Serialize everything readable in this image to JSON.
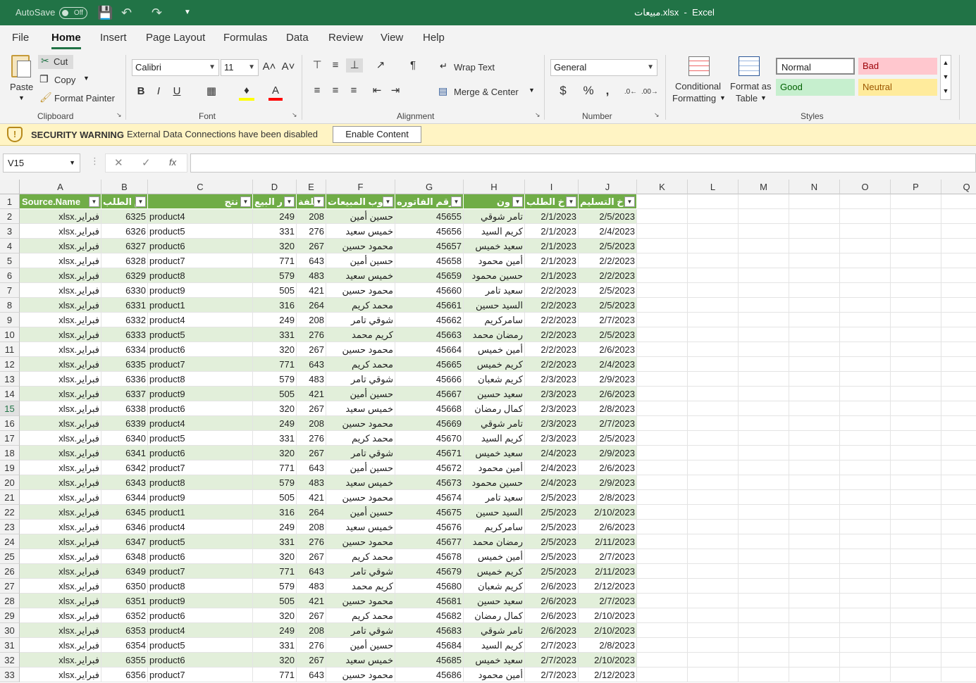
{
  "titlebar": {
    "autosave_label": "AutoSave",
    "autosave_state": "Off",
    "filename": "مبيعات.xlsx",
    "app": "Excel"
  },
  "menu": [
    "File",
    "Home",
    "Insert",
    "Page Layout",
    "Formulas",
    "Data",
    "Review",
    "View",
    "Help"
  ],
  "ribbon": {
    "clipboard": {
      "paste": "Paste",
      "cut": "Cut",
      "copy": "Copy",
      "format_painter": "Format Painter",
      "label": "Clipboard"
    },
    "font": {
      "name": "Calibri",
      "size": "11",
      "label": "Font",
      "bold": "B",
      "italic": "I",
      "underline": "U"
    },
    "alignment": {
      "wrap_text": "Wrap Text",
      "merge_center": "Merge & Center",
      "label": "Alignment"
    },
    "number": {
      "format": "General",
      "label": "Number"
    },
    "styles": {
      "conditional": "Conditional",
      "formatting": "Formatting",
      "format_as": "Format as",
      "table": "Table",
      "normal": "Normal",
      "bad": "Bad",
      "good": "Good",
      "neutral": "Neutral",
      "label": "Styles"
    }
  },
  "security": {
    "title": "SECURITY WARNING",
    "message": "External Data Connections have been disabled",
    "button": "Enable Content"
  },
  "formula_bar": {
    "name_box": "V15",
    "fx": "fx"
  },
  "columns": [
    "A",
    "B",
    "C",
    "D",
    "E",
    "F",
    "G",
    "H",
    "I",
    "J",
    "K",
    "L",
    "M",
    "N",
    "O",
    "P",
    "Q"
  ],
  "header_row": [
    "Source.Name",
    "م الطلب",
    "نتج",
    "ر البيع",
    "كلفة",
    "وب المبيعات",
    "رقم الفاتوره.",
    "ون",
    "خ الطلب",
    "خ التسليم"
  ],
  "rows": [
    [
      "فبراير.xlsx",
      "6325",
      "product4",
      "249",
      "208",
      "حسين أمين",
      "45655",
      "تامر شوقي",
      "2/1/2023",
      "2/5/2023"
    ],
    [
      "فبراير.xlsx",
      "6326",
      "product5",
      "331",
      "276",
      "خميس سعيد",
      "45656",
      "كريم السيد",
      "2/1/2023",
      "2/4/2023"
    ],
    [
      "فبراير.xlsx",
      "6327",
      "product6",
      "320",
      "267",
      "محمود حسين",
      "45657",
      "سعيد خميس",
      "2/1/2023",
      "2/5/2023"
    ],
    [
      "فبراير.xlsx",
      "6328",
      "product7",
      "771",
      "643",
      "حسين أمين",
      "45658",
      "أمين محمود",
      "2/1/2023",
      "2/2/2023"
    ],
    [
      "فبراير.xlsx",
      "6329",
      "product8",
      "579",
      "483",
      "خميس سعيد",
      "45659",
      "حسين محمود",
      "2/1/2023",
      "2/2/2023"
    ],
    [
      "فبراير.xlsx",
      "6330",
      "product9",
      "505",
      "421",
      "محمود حسين",
      "45660",
      "سعيد تامر",
      "2/2/2023",
      "2/5/2023"
    ],
    [
      "فبراير.xlsx",
      "6331",
      "product1",
      "316",
      "264",
      "محمد كريم",
      "45661",
      "السيد حسين",
      "2/2/2023",
      "2/5/2023"
    ],
    [
      "فبراير.xlsx",
      "6332",
      "product4",
      "249",
      "208",
      "شوقي تامر",
      "45662",
      "سامركريم",
      "2/2/2023",
      "2/7/2023"
    ],
    [
      "فبراير.xlsx",
      "6333",
      "product5",
      "331",
      "276",
      "كريم محمد",
      "45663",
      "رمضان محمد",
      "2/2/2023",
      "2/5/2023"
    ],
    [
      "فبراير.xlsx",
      "6334",
      "product6",
      "320",
      "267",
      "محمود حسين",
      "45664",
      "أمين خميس",
      "2/2/2023",
      "2/6/2023"
    ],
    [
      "فبراير.xlsx",
      "6335",
      "product7",
      "771",
      "643",
      "محمد كريم",
      "45665",
      "كريم خميس",
      "2/2/2023",
      "2/4/2023"
    ],
    [
      "فبراير.xlsx",
      "6336",
      "product8",
      "579",
      "483",
      "شوقي تامر",
      "45666",
      "كريم شعبان",
      "2/3/2023",
      "2/9/2023"
    ],
    [
      "فبراير.xlsx",
      "6337",
      "product9",
      "505",
      "421",
      "حسين أمين",
      "45667",
      "سعيد حسين",
      "2/3/2023",
      "2/6/2023"
    ],
    [
      "فبراير.xlsx",
      "6338",
      "product6",
      "320",
      "267",
      "خميس سعيد",
      "45668",
      "كمال رمضان",
      "2/3/2023",
      "2/8/2023"
    ],
    [
      "فبراير.xlsx",
      "6339",
      "product4",
      "249",
      "208",
      "محمود حسين",
      "45669",
      "تامر شوقي",
      "2/3/2023",
      "2/7/2023"
    ],
    [
      "فبراير.xlsx",
      "6340",
      "product5",
      "331",
      "276",
      "محمد كريم",
      "45670",
      "كريم السيد",
      "2/3/2023",
      "2/5/2023"
    ],
    [
      "فبراير.xlsx",
      "6341",
      "product6",
      "320",
      "267",
      "شوقي تامر",
      "45671",
      "سعيد خميس",
      "2/4/2023",
      "2/9/2023"
    ],
    [
      "فبراير.xlsx",
      "6342",
      "product7",
      "771",
      "643",
      "حسين أمين",
      "45672",
      "أمين محمود",
      "2/4/2023",
      "2/6/2023"
    ],
    [
      "فبراير.xlsx",
      "6343",
      "product8",
      "579",
      "483",
      "خميس سعيد",
      "45673",
      "حسين محمود",
      "2/4/2023",
      "2/9/2023"
    ],
    [
      "فبراير.xlsx",
      "6344",
      "product9",
      "505",
      "421",
      "محمود حسين",
      "45674",
      "سعيد تامر",
      "2/5/2023",
      "2/8/2023"
    ],
    [
      "فبراير.xlsx",
      "6345",
      "product1",
      "316",
      "264",
      "حسين أمين",
      "45675",
      "السيد حسين",
      "2/5/2023",
      "2/10/2023"
    ],
    [
      "فبراير.xlsx",
      "6346",
      "product4",
      "249",
      "208",
      "خميس سعيد",
      "45676",
      "سامركريم",
      "2/5/2023",
      "2/6/2023"
    ],
    [
      "فبراير.xlsx",
      "6347",
      "product5",
      "331",
      "276",
      "محمود حسين",
      "45677",
      "رمضان محمد",
      "2/5/2023",
      "2/11/2023"
    ],
    [
      "فبراير.xlsx",
      "6348",
      "product6",
      "320",
      "267",
      "محمد كريم",
      "45678",
      "أمين خميس",
      "2/5/2023",
      "2/7/2023"
    ],
    [
      "فبراير.xlsx",
      "6349",
      "product7",
      "771",
      "643",
      "شوقي تامر",
      "45679",
      "كريم خميس",
      "2/5/2023",
      "2/11/2023"
    ],
    [
      "فبراير.xlsx",
      "6350",
      "product8",
      "579",
      "483",
      "كريم محمد",
      "45680",
      "كريم شعبان",
      "2/6/2023",
      "2/12/2023"
    ],
    [
      "فبراير.xlsx",
      "6351",
      "product9",
      "505",
      "421",
      "محمود حسين",
      "45681",
      "سعيد حسين",
      "2/6/2023",
      "2/7/2023"
    ],
    [
      "فبراير.xlsx",
      "6352",
      "product6",
      "320",
      "267",
      "محمد كريم",
      "45682",
      "كمال رمضان",
      "2/6/2023",
      "2/10/2023"
    ],
    [
      "فبراير.xlsx",
      "6353",
      "product4",
      "249",
      "208",
      "شوقي تامر",
      "45683",
      "تامر شوقي",
      "2/6/2023",
      "2/10/2023"
    ],
    [
      "فبراير.xlsx",
      "6354",
      "product5",
      "331",
      "276",
      "حسين أمين",
      "45684",
      "كريم السيد",
      "2/7/2023",
      "2/8/2023"
    ],
    [
      "فبراير.xlsx",
      "6355",
      "product6",
      "320",
      "267",
      "خميس سعيد",
      "45685",
      "سعيد خميس",
      "2/7/2023",
      "2/10/2023"
    ],
    [
      "فبراير.xlsx",
      "6356",
      "product7",
      "771",
      "643",
      "محمود حسين",
      "45686",
      "أمين محمود",
      "2/7/2023",
      "2/12/2023"
    ]
  ],
  "selected_row": 15,
  "colors": {
    "excel_green": "#217346",
    "table_header": "#70ad47",
    "band": "#e2efda"
  }
}
